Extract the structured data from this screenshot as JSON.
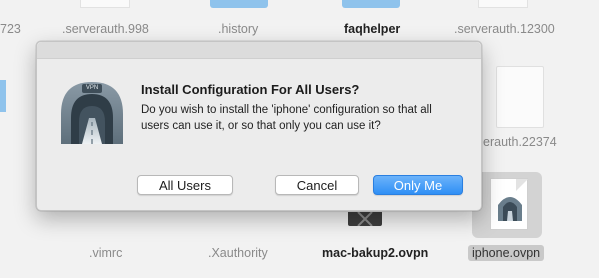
{
  "background_files": {
    "top_row": [
      {
        "label": "723",
        "selected": false,
        "bold": false
      },
      {
        "label": ".serverauth.998",
        "selected": false,
        "bold": false
      },
      {
        "label": ".history",
        "selected": false,
        "bold": false
      },
      {
        "label": "faqhelper",
        "selected": false,
        "bold": true
      },
      {
        "label": ".serverauth.12300",
        "selected": false,
        "bold": false
      }
    ],
    "middle_right": {
      "label": "erauth.22374"
    },
    "bottom_row": [
      {
        "label": ".vimrc",
        "selected": false,
        "bold": false
      },
      {
        "label": ".Xauthority",
        "selected": false,
        "bold": false
      },
      {
        "label": "mac-bakup2.ovpn",
        "selected": false,
        "bold": true
      },
      {
        "label": "iphone.ovpn",
        "selected": true,
        "bold": false
      }
    ]
  },
  "dialog": {
    "title": "Install Configuration For All Users?",
    "message": "Do you wish to install the 'iphone' configuration so that all users can use it, or so that only you can use it?",
    "icon": "vpn-tunnel-icon",
    "icon_badge": "VPN",
    "buttons": {
      "all_users": "All Users",
      "cancel": "Cancel",
      "only_me": "Only Me"
    }
  },
  "colors": {
    "primary_button": "#2f8ff5",
    "dialog_bg": "#ececec",
    "folder_blue": "#8fc3ec"
  }
}
